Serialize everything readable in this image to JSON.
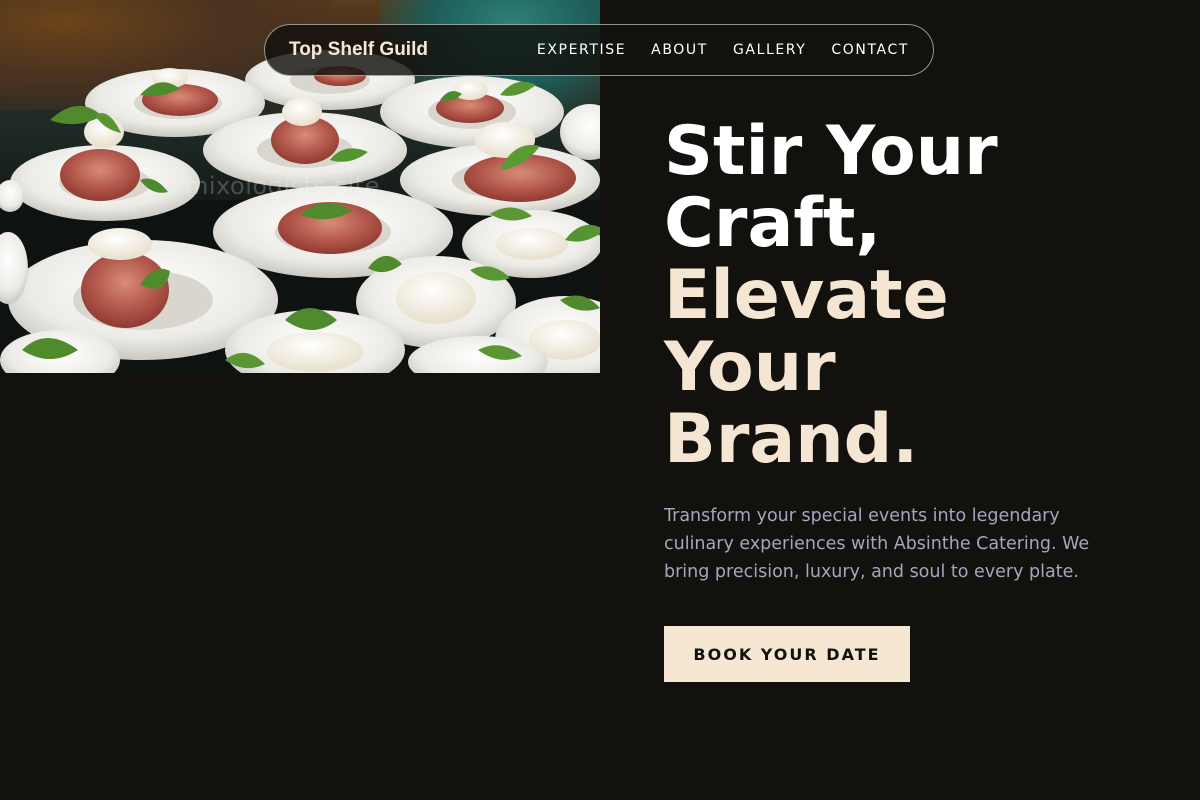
{
  "nav": {
    "brand": "Top Shelf Guild",
    "links": [
      "EXPERTISE",
      "ABOUT",
      "GALLERY",
      "CONTACT"
    ]
  },
  "hero": {
    "image": {
      "description": "Appetizer plates with prosciutto and mozzarella",
      "watermark": "mixologists.site"
    },
    "headline": {
      "line1": "Stir Your",
      "line2": "Craft,",
      "line3": "Elevate",
      "line4": "Your",
      "line5": "Brand."
    },
    "subtext": "Transform your special events into legendary culinary experiences with Absinthe Catering. We bring precision, luxury, and soul to every plate.",
    "cta_label": "BOOK YOUR DATE"
  },
  "colors": {
    "background": "#13110e",
    "accent": "#f5e6d3",
    "body_text": "#a2a7bd",
    "heading": "#ffffff"
  }
}
